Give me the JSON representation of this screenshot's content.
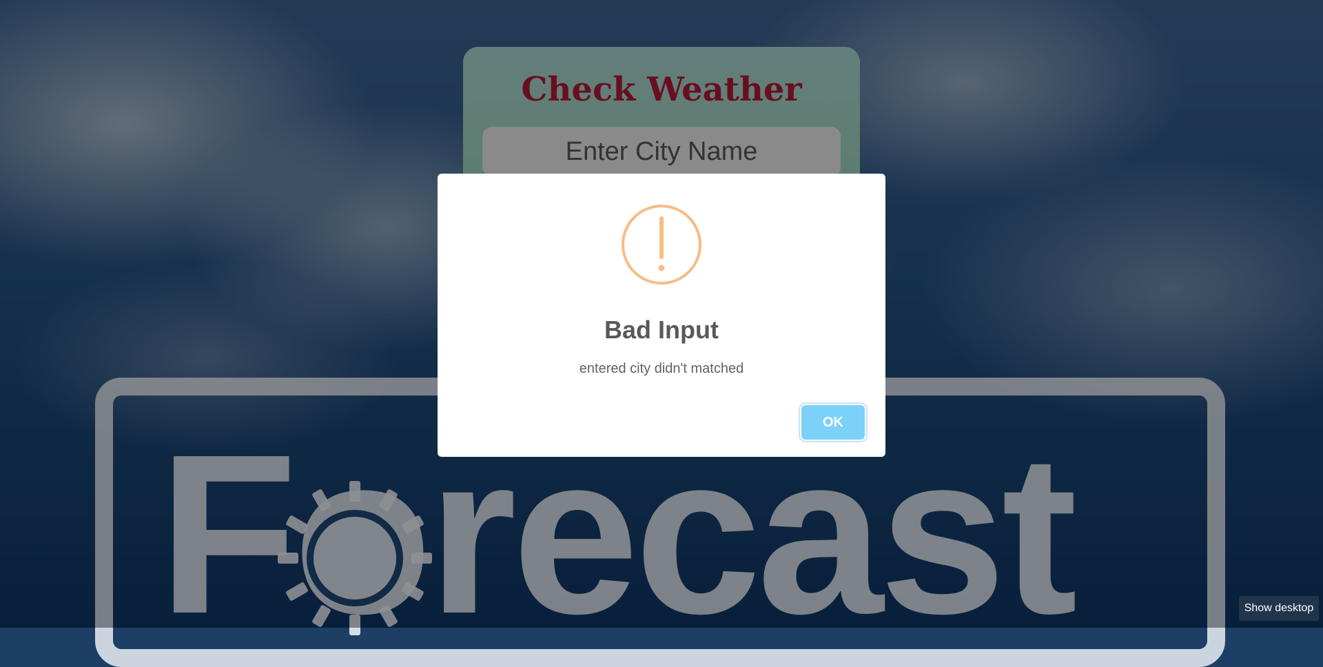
{
  "app": {
    "title": "Check Weather",
    "city_input": {
      "placeholder": "Enter City Name",
      "value": ""
    }
  },
  "background": {
    "logo_text": "Forecast"
  },
  "alert": {
    "icon": "warning-icon",
    "title": "Bad Input",
    "text": "entered city didn't matched",
    "confirm_label": "OK"
  },
  "taskbar": {
    "tooltip": "Show desktop"
  },
  "colors": {
    "title": "#b01838",
    "warning": "#f8bb86",
    "confirm": "#7cd1f9"
  }
}
